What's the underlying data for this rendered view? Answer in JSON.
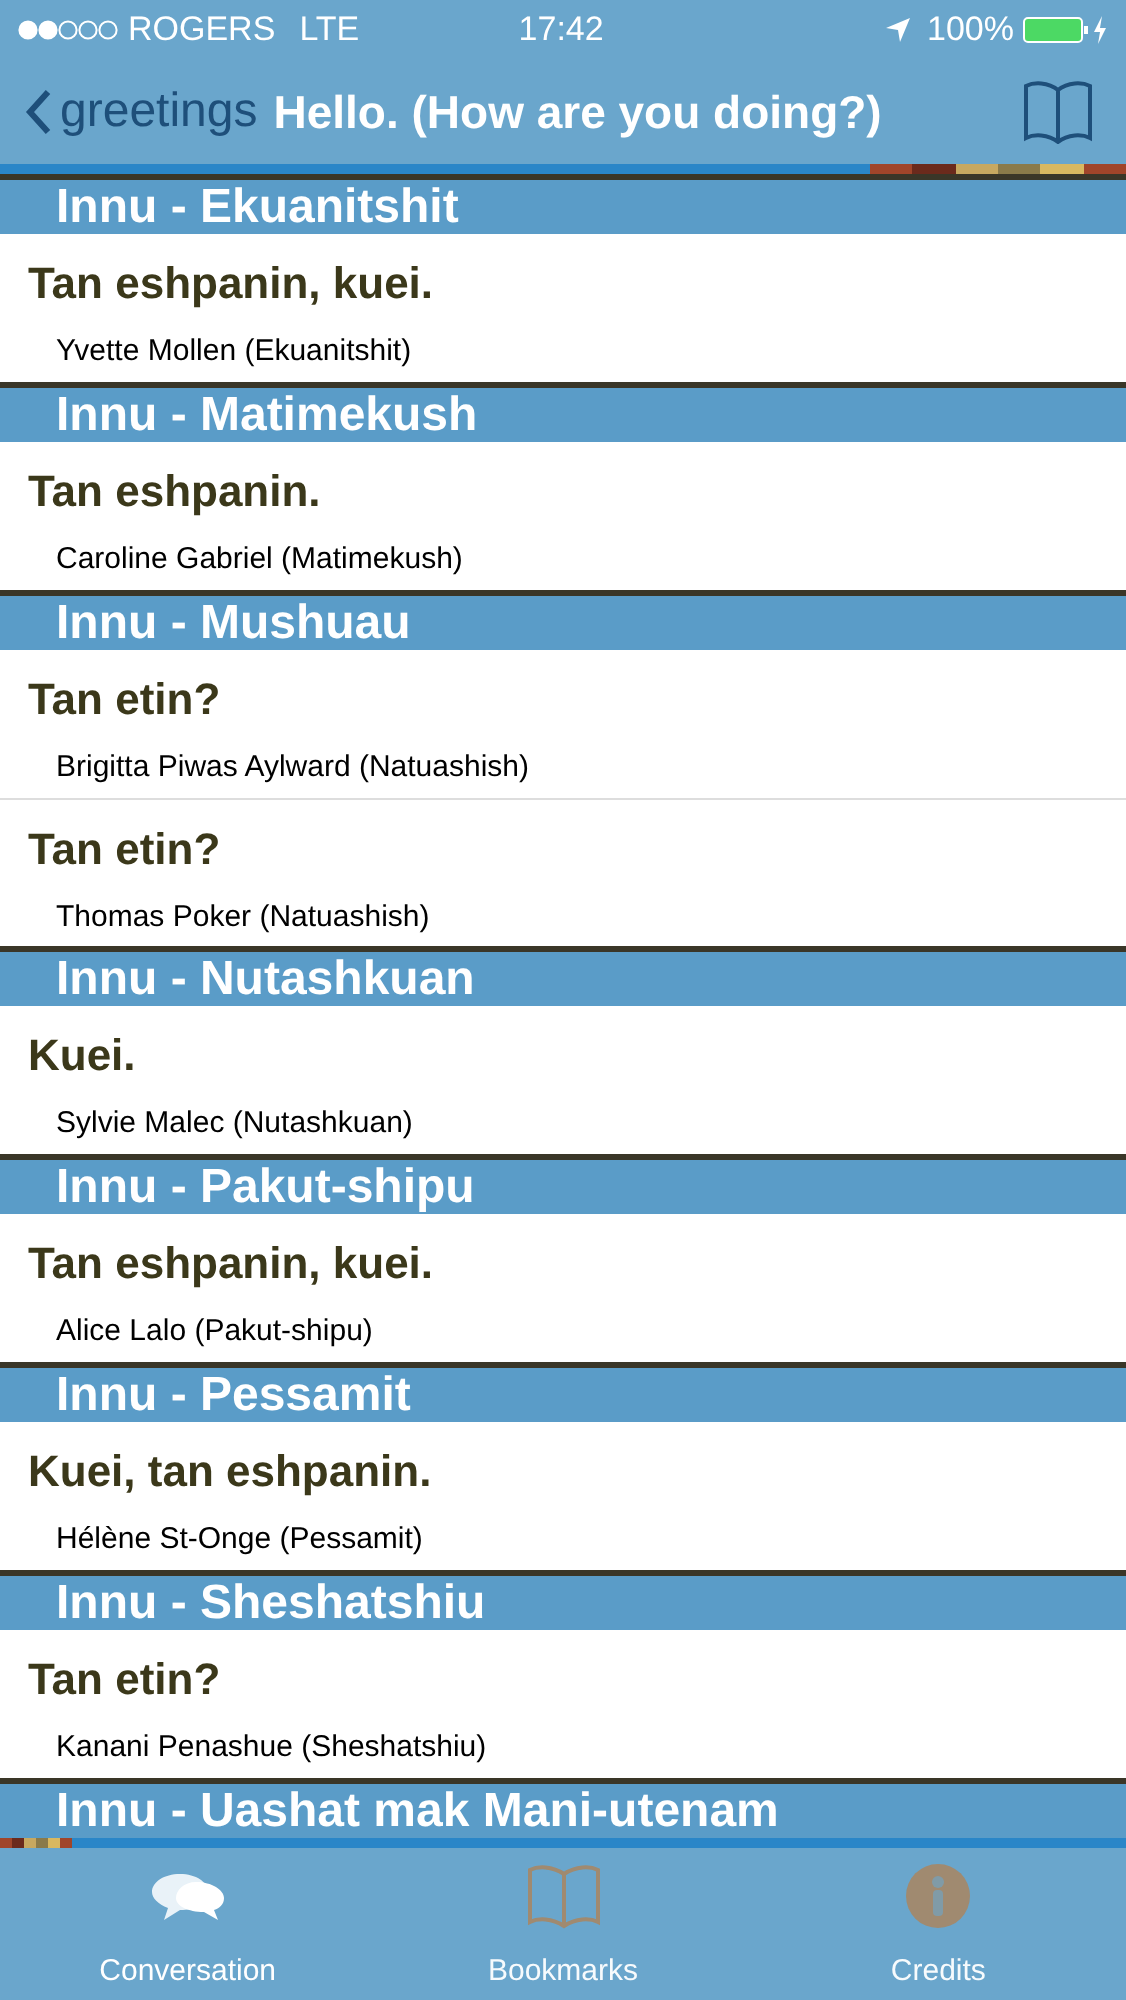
{
  "status_bar": {
    "carrier": "ROGERS",
    "network": "LTE",
    "time": "17:42",
    "battery": "100%"
  },
  "nav": {
    "back": "greetings",
    "title": "Hello. (How are you doing?)"
  },
  "sections": [
    {
      "title": "Innu - Ekuanitshit",
      "entries": [
        {
          "phrase": "Tan eshpanin, kuei.",
          "speaker": "Yvette Mollen (Ekuanitshit)"
        }
      ]
    },
    {
      "title": "Innu - Matimekush",
      "entries": [
        {
          "phrase": "Tan eshpanin.",
          "speaker": "Caroline Gabriel (Matimekush)"
        }
      ]
    },
    {
      "title": "Innu - Mushuau",
      "entries": [
        {
          "phrase": "Tan etin?",
          "speaker": "Brigitta Piwas Aylward (Natuashish)"
        },
        {
          "phrase": "Tan etin?",
          "speaker": "Thomas Poker (Natuashish)"
        }
      ]
    },
    {
      "title": "Innu - Nutashkuan",
      "entries": [
        {
          "phrase": "Kuei.",
          "speaker": "Sylvie Malec (Nutashkuan)"
        }
      ]
    },
    {
      "title": "Innu - Pakut-shipu",
      "entries": [
        {
          "phrase": "Tan eshpanin, kuei.",
          "speaker": "Alice Lalo (Pakut-shipu)"
        }
      ]
    },
    {
      "title": "Innu - Pessamit",
      "entries": [
        {
          "phrase": "Kuei, tan eshpanin.",
          "speaker": "Hélène St-Onge (Pessamit)"
        }
      ]
    },
    {
      "title": "Innu - Sheshatshiu",
      "entries": [
        {
          "phrase": "Tan etin?",
          "speaker": "Kanani Penashue (Sheshatshiu)"
        }
      ]
    },
    {
      "title": "Innu - Uashat mak Mani-utenam"
    }
  ],
  "tabs": [
    {
      "kind": "conversation",
      "label": "Conversation",
      "selected": true
    },
    {
      "kind": "bookmarks",
      "label": "Bookmarks",
      "selected": false
    },
    {
      "kind": "credits",
      "label": "Credits",
      "selected": false
    }
  ]
}
